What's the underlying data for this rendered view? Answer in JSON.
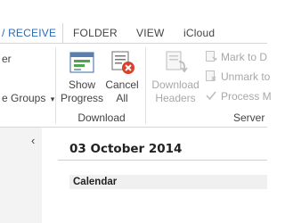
{
  "tabs": {
    "active": "/ RECEIVE",
    "folder": "FOLDER",
    "view": "VIEW",
    "icloud": "iCloud"
  },
  "ribbon": {
    "left_partial_top": "er",
    "left_partial_groups": "e Groups",
    "groups_dropdown_glyph": "▾",
    "show_progress_line1": "Show",
    "show_progress_line2": "Progress",
    "cancel_all_line1": "Cancel",
    "cancel_all_line2": "All",
    "download_group_label": "Download",
    "download_headers_line1": "Download",
    "download_headers_line2": "Headers",
    "mark_to_download": "Mark to D",
    "unmark_to": "Unmark to",
    "process_marked": "Process M",
    "server_group_label": "Server"
  },
  "content": {
    "collapse_glyph": "‹",
    "date_title": "03 October 2014",
    "calendar_label": "Calendar"
  },
  "colors": {
    "accent": "#2b6cb3",
    "cancel_red": "#d9412b",
    "disabled_text": "#a8a8a8"
  }
}
